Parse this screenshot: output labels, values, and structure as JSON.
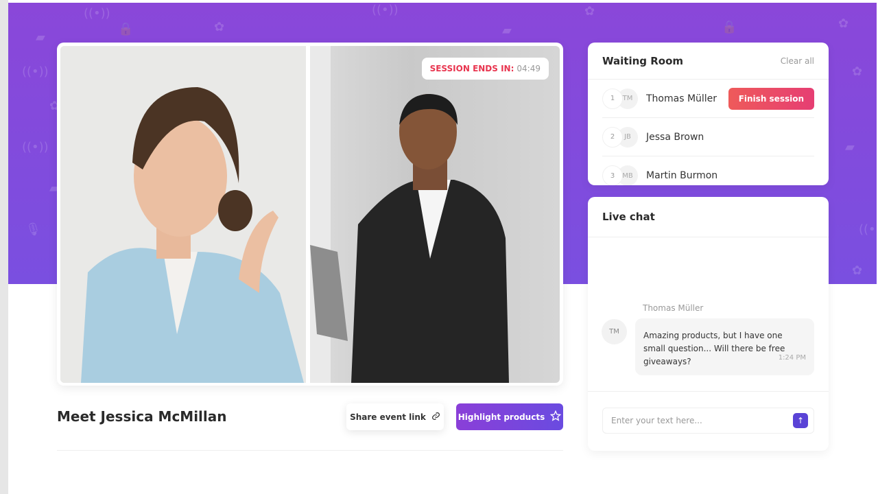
{
  "colors": {
    "accent": "#7a4fe0",
    "danger": "#e8354f",
    "banner": "#8a47d9"
  },
  "video": {
    "timer_label": "SESSION ENDS IN:",
    "timer_value": "04:49"
  },
  "main": {
    "title": "Meet Jessica McMillan",
    "share_label": "Share event link",
    "share_icon": "link-icon",
    "highlight_label": "Highlight products",
    "highlight_icon": "star-icon"
  },
  "waiting_room": {
    "title": "Waiting Room",
    "clear_label": "Clear all",
    "finish_label": "Finish session",
    "items": [
      {
        "num": "1",
        "initials": "TM",
        "name": "Thomas Müller"
      },
      {
        "num": "2",
        "initials": "JB",
        "name": "Jessa Brown"
      },
      {
        "num": "3",
        "initials": "MB",
        "name": "Martin Burmon"
      }
    ]
  },
  "chat": {
    "title": "Live chat",
    "messages": [
      {
        "sender": "Thomas Müller",
        "initials": "TM",
        "text": "Amazing products, but I have one small question... Will there be free giveaways?",
        "time": "1:24 PM"
      }
    ],
    "placeholder": "Enter your text here...",
    "send_icon": "arrow-up-icon"
  }
}
